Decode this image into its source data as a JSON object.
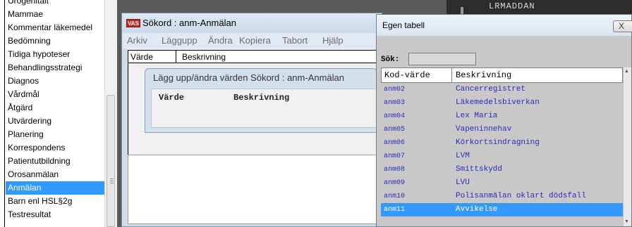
{
  "left_list": {
    "items": [
      {
        "label": "Urogenitalt"
      },
      {
        "label": "Mammae"
      },
      {
        "label": "Kommentar läkemedel"
      },
      {
        "label": "Bedömning"
      },
      {
        "label": "Tidiga hypoteser"
      },
      {
        "label": "Behandlingsstrategi"
      },
      {
        "label": "Diagnos"
      },
      {
        "label": "Vårdmål"
      },
      {
        "label": "Åtgärd"
      },
      {
        "label": "Utvärdering"
      },
      {
        "label": "Planering"
      },
      {
        "label": "Korrespondens"
      },
      {
        "label": "Patientutbildning"
      },
      {
        "label": "Orosanmälan"
      },
      {
        "label": "Anmälan",
        "selected": true
      },
      {
        "label": "Barn enl HSL§2g"
      },
      {
        "label": "Testresultat"
      }
    ]
  },
  "background_text": "LRMADDAN",
  "sokord_window": {
    "app_icon": "VAS",
    "title": "Sökord : anm-Anmälan",
    "menu": [
      "Arkiv",
      "Läggupp",
      "Ändra",
      "Kopiera",
      "Tabort",
      "Hjälp"
    ],
    "grid_columns": [
      "Värde",
      "Beskrivning"
    ]
  },
  "edit_dialog": {
    "title": "Lägg upp/ändra värden Sökord : anm-Anmälan",
    "columns": [
      "Värde",
      "Beskrivning"
    ]
  },
  "egen_tabell": {
    "title": "Egen tabell",
    "close_label": "X",
    "search_label": "Sök:",
    "search_value": "",
    "columns": [
      "Kod-värde",
      "Beskrivning"
    ],
    "rows": [
      {
        "kod": "anm02",
        "beskrivning": "Cancerregistret"
      },
      {
        "kod": "anm03",
        "beskrivning": "Läkemedelsbiverkan"
      },
      {
        "kod": "anm04",
        "beskrivning": "Lex Maria"
      },
      {
        "kod": "anm05",
        "beskrivning": "Vapeninnehav"
      },
      {
        "kod": "anm06",
        "beskrivning": "Körkortsindragning"
      },
      {
        "kod": "anm07",
        "beskrivning": "LVM"
      },
      {
        "kod": "anm08",
        "beskrivning": "Smittskydd"
      },
      {
        "kod": "anm09",
        "beskrivning": "LVU"
      },
      {
        "kod": "anm10",
        "beskrivning": "Polisanmälan oklart dödsfall"
      },
      {
        "kod": "anm11",
        "beskrivning": "Avvikelse",
        "selected": true
      }
    ]
  },
  "colors": {
    "selection": "#3399ff",
    "table_text": "#2a2ab8",
    "app_icon_red": "#c0271e"
  }
}
